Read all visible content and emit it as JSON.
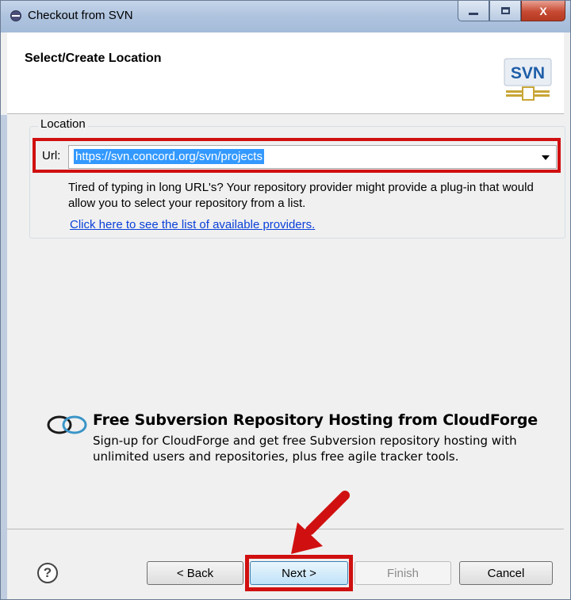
{
  "window": {
    "title": "Checkout from SVN",
    "controls": {
      "minimize": "minimize-button",
      "maximize": "maximize-button",
      "close": "X"
    }
  },
  "header": {
    "title": "Select/Create Location",
    "logo_text": "SVN"
  },
  "location": {
    "group_label": "Location",
    "url_label": "Url:",
    "url_value": "https://svn.concord.org/svn/projects",
    "help_text": "Tired of typing in long URL's?  Your repository provider might provide a plug-in that would allow you to select your repository from a list.",
    "providers_link": "Click here to see the list of available providers."
  },
  "cloudforge": {
    "icon": "cloudforge-icon",
    "title": "Free Subversion Repository Hosting from CloudForge",
    "description": "Sign-up for CloudForge and get free Subversion repository hosting with unlimited users and repositories, plus free agile tracker tools."
  },
  "footer": {
    "help_icon": "?",
    "back_label": "< Back",
    "next_label": "Next >",
    "finish_label": "Finish",
    "cancel_label": "Cancel"
  },
  "colors": {
    "highlight": "#d01010",
    "link": "#0a40d8",
    "selection": "#3399ff"
  }
}
